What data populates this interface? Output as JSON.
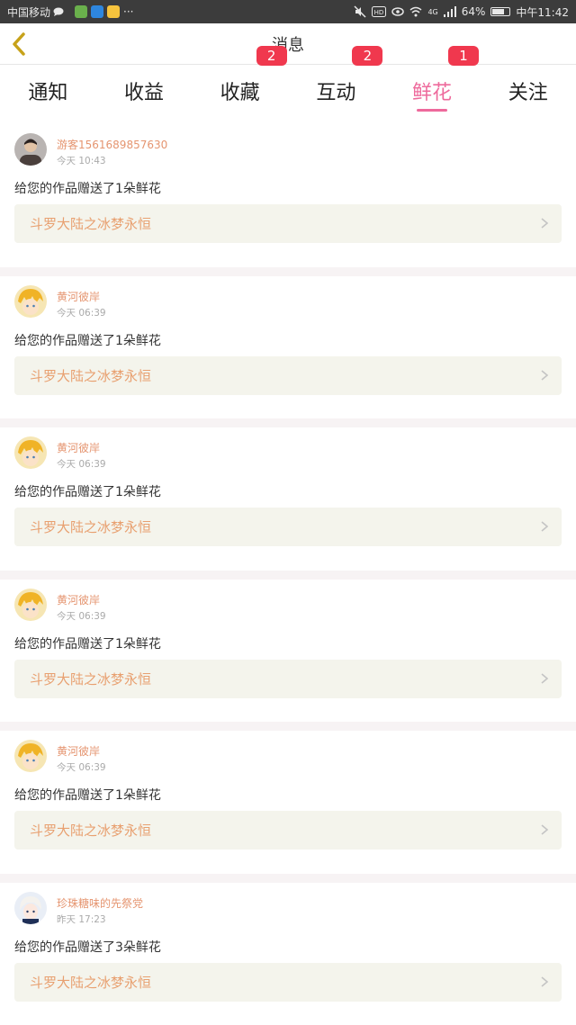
{
  "status_bar": {
    "carrier": "中国移动",
    "more": "···",
    "network": "4G",
    "battery": "64%",
    "battery_level": 0.64,
    "time": "中午11:42"
  },
  "header": {
    "title": "消息"
  },
  "tabs": [
    {
      "label": "通知",
      "badge": ""
    },
    {
      "label": "收益",
      "badge": ""
    },
    {
      "label": "收藏",
      "badge": "2"
    },
    {
      "label": "互动",
      "badge": "2"
    },
    {
      "label": "鲜花",
      "badge": "1",
      "active": true
    },
    {
      "label": "关注",
      "badge": ""
    }
  ],
  "messages": [
    {
      "name": "游客1561689857630",
      "time": "今天 10:43",
      "text": "给您的作品赠送了1朵鲜花",
      "work": "斗罗大陆之冰梦永恒",
      "avatar": "person-photo"
    },
    {
      "name": "黄河彼岸",
      "time": "今天 06:39",
      "text": "给您的作品赠送了1朵鲜花",
      "work": "斗罗大陆之冰梦永恒",
      "avatar": "anime-boy"
    },
    {
      "name": "黄河彼岸",
      "time": "今天 06:39",
      "text": "给您的作品赠送了1朵鲜花",
      "work": "斗罗大陆之冰梦永恒",
      "avatar": "anime-boy"
    },
    {
      "name": "黄河彼岸",
      "time": "今天 06:39",
      "text": "给您的作品赠送了1朵鲜花",
      "work": "斗罗大陆之冰梦永恒",
      "avatar": "anime-boy"
    },
    {
      "name": "黄河彼岸",
      "time": "今天 06:39",
      "text": "给您的作品赠送了1朵鲜花",
      "work": "斗罗大陆之冰梦永恒",
      "avatar": "anime-boy"
    },
    {
      "name": "珍珠糖味的先祭党",
      "time": "昨天 17:23",
      "text": "给您的作品赠送了3朵鲜花",
      "work": "斗罗大陆之冰梦永恒",
      "avatar": "anime-girl"
    }
  ],
  "colors": {
    "accent": "#ee6a9c",
    "badge": "#f0384e",
    "name": "#e59570",
    "work": "#e8a070"
  }
}
